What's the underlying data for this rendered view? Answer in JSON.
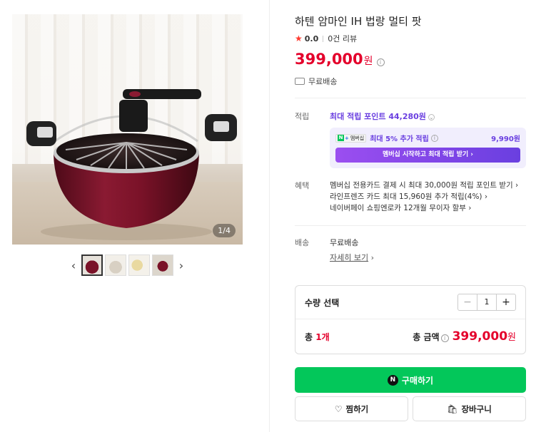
{
  "gallery": {
    "counter_current": "1",
    "counter_total": "4",
    "counter_sep": "/",
    "prev_icon": "‹",
    "next_icon": "›"
  },
  "product": {
    "title": "하텐 암마인 IH 법랑 멀티 팟",
    "rating": "0.0",
    "review_count": "0건 리뷰",
    "price": "399,000",
    "price_unit": "원",
    "shipping": "무료배송"
  },
  "points": {
    "label": "적립",
    "headline": "최대 적립 포인트 44,280원",
    "member_badge": "멤버십",
    "member_text": "최대 5% 추가 적립",
    "member_value": "9,990원",
    "member_button": "멤버십 시작하고 최대 적립 받기 ›"
  },
  "benefits": {
    "label": "혜택",
    "items": [
      "멤버십 전용카드 결제 시 최대 30,000원 적립 포인트 받기 ›",
      "라인프렌즈 카드 최대 15,960원 추가 적립(4%) ›",
      "네이버페이 쇼핑엔로카 12개월 무이자 할부 ›"
    ]
  },
  "delivery": {
    "label": "배송",
    "value": "무료배송",
    "detail_link": "자세히 보기",
    "detail_arrow": "›"
  },
  "quantity": {
    "label": "수량 선택",
    "minus": "−",
    "value": "1",
    "plus": "+",
    "total_count_prefix": "총 ",
    "total_count": "1개",
    "total_label": "총 금액",
    "total_price": "399,000",
    "total_unit": "원"
  },
  "actions": {
    "buy_icon": "N",
    "buy_label": "구매하기",
    "wish_label": "찜하기",
    "cart_label": "장바구니"
  },
  "colors": {
    "price_red": "#e4002b",
    "naver_green": "#03c75a",
    "member_purple": "#6a3fe0"
  }
}
